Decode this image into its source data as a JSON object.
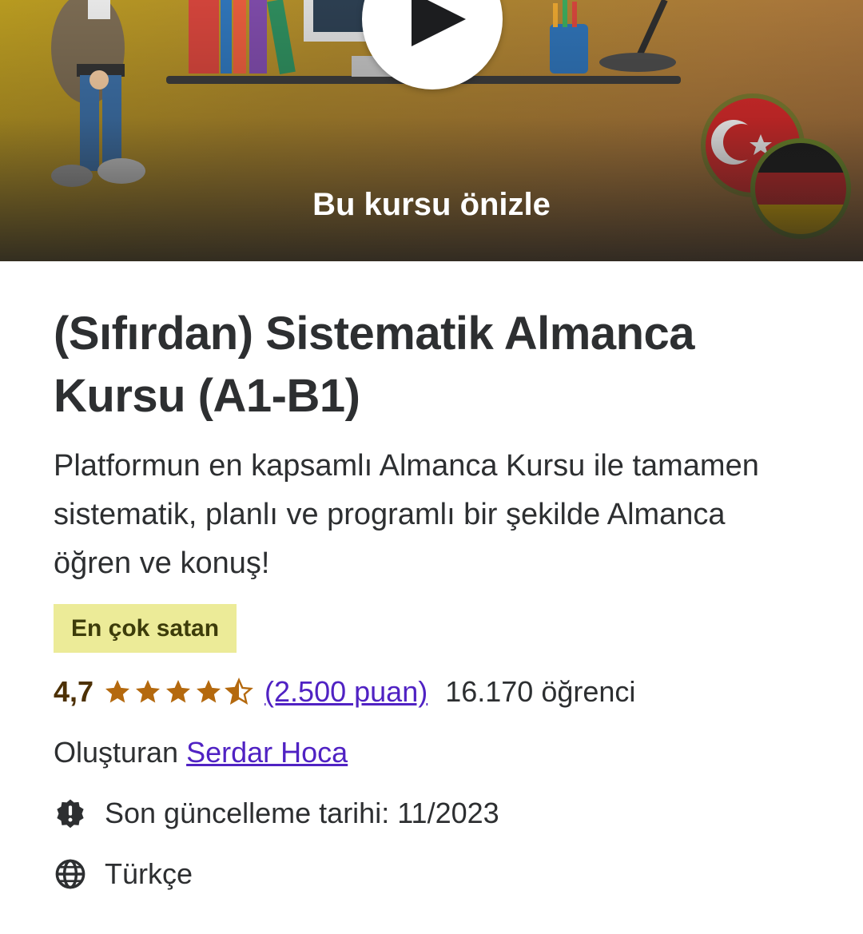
{
  "hero": {
    "preview_label": "Bu kursu önizle",
    "play_icon": "play-icon"
  },
  "course": {
    "title": "(Sıfırdan) Sistematik Almanca Kursu (A1-B1)",
    "subtitle": "Platformun en kapsamlı Almanca Kursu ile tamamen sistematik, planlı ve programlı bir şekilde Almanca öğren ve konuş!",
    "badge": "En çok satan",
    "rating": {
      "value": "4,7",
      "stars": 4.7,
      "count_label": "(2.500 puan)",
      "students": "16.170 öğrenci"
    },
    "creator": {
      "prefix": "Oluşturan",
      "name": "Serdar Hoca"
    },
    "last_updated": "Son güncelleme tarihi: 11/2023",
    "language": "Türkçe"
  },
  "colors": {
    "badge_bg": "#eceb98",
    "star": "#b4690e",
    "link": "#5022c3",
    "text": "#2d2f31"
  },
  "icons": {
    "updated": "alert-badge-icon",
    "language": "globe-icon"
  }
}
